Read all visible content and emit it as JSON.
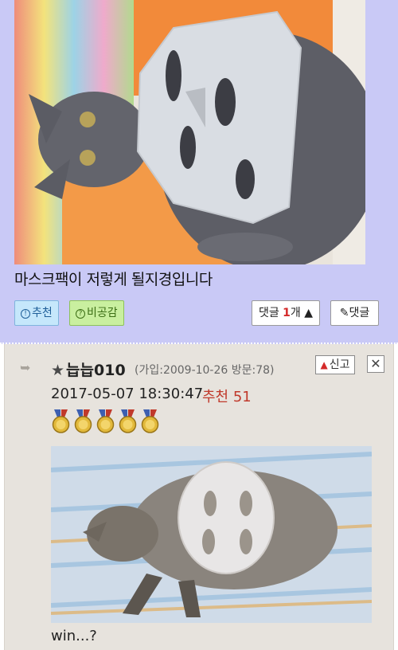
{
  "post": {
    "photo_alt": "",
    "text": "마스크팩이 저렇게 될지경입니다",
    "upvote_label": "추천",
    "downvote_label": "비공감",
    "comment_count_label_prefix": "댓글 ",
    "comment_count": "1",
    "comment_count_label_suffix": "개 ▲",
    "write_comment_label": "댓글"
  },
  "comment": {
    "nickname": "늡늡010",
    "user_meta": "(가입:2009-10-26 방문:78)",
    "report_label": "신고",
    "close_label": "✕",
    "datetime": "2017-05-07 18:30:47",
    "recommend_label": "추천 51",
    "medal_count": 5,
    "text": "win...?"
  },
  "colors": {
    "post_bg": "#c9c9f6",
    "comment_bg": "#e7e3dd",
    "accent_red": "#d42a2a"
  }
}
